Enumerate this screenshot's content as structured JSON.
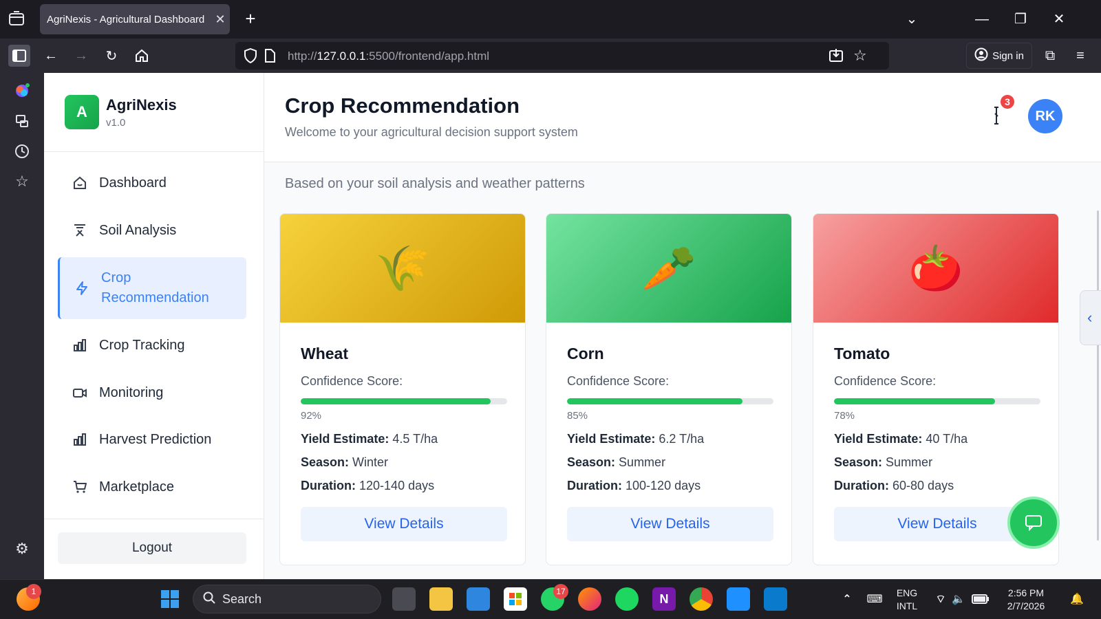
{
  "browser": {
    "tab_title": "AgriNexis - Agricultural Dashboard",
    "url_prefix": "http://",
    "url_host": "127.0.0.1",
    "url_rest": ":5500/frontend/app.html",
    "sign_in": "Sign in"
  },
  "app": {
    "brand_initial": "A",
    "brand_name": "AgriNexis",
    "brand_version": "v1.0",
    "menu": [
      {
        "label": "Dashboard",
        "icon": "home-icon"
      },
      {
        "label": "Soil Analysis",
        "icon": "soil-icon"
      },
      {
        "label": "Crop Recommendation",
        "icon": "bolt-icon",
        "active": true
      },
      {
        "label": "Crop Tracking",
        "icon": "bar-chart-icon"
      },
      {
        "label": "Monitoring",
        "icon": "video-icon"
      },
      {
        "label": "Harvest Prediction",
        "icon": "bar-chart-icon"
      },
      {
        "label": "Marketplace",
        "icon": "cart-icon"
      }
    ],
    "logout": "Logout"
  },
  "header": {
    "title": "Crop Recommendation",
    "subtitle": "Welcome to your agricultural decision support system",
    "notification_count": "3",
    "avatar_initials": "RK"
  },
  "main": {
    "section_subtitle": "Based on your soil analysis and weather patterns",
    "cards": [
      {
        "name": "Wheat",
        "emoji": "🌾",
        "confidence_label": "Confidence Score:",
        "confidence": 92,
        "confidence_text": "92%",
        "yield_label": "Yield Estimate:",
        "yield": "4.5 T/ha",
        "season_label": "Season:",
        "season": "Winter",
        "duration_label": "Duration:",
        "duration": "120-140 days",
        "button": "View Details",
        "gradient": [
          "#f6d23c",
          "#cf9a06"
        ]
      },
      {
        "name": "Corn",
        "emoji": "🥕",
        "confidence_label": "Confidence Score:",
        "confidence": 85,
        "confidence_text": "85%",
        "yield_label": "Yield Estimate:",
        "yield": "6.2 T/ha",
        "season_label": "Season:",
        "season": "Summer",
        "duration_label": "Duration:",
        "duration": "100-120 days",
        "button": "View Details",
        "gradient": [
          "#74e3a0",
          "#16a34a"
        ]
      },
      {
        "name": "Tomato",
        "emoji": "🍅",
        "confidence_label": "Confidence Score:",
        "confidence": 78,
        "confidence_text": "78%",
        "yield_label": "Yield Estimate:",
        "yield": "40 T/ha",
        "season_label": "Season:",
        "season": "Summer",
        "duration_label": "Duration:",
        "duration": "60-80 days",
        "button": "View Details",
        "gradient": [
          "#f7a0a0",
          "#e02a2a"
        ]
      }
    ]
  },
  "taskbar": {
    "search": "Search",
    "badge_left": "1",
    "whatsapp_badge": "17",
    "lang_top": "ENG",
    "lang_bottom": "INTL",
    "time": "2:56 PM",
    "date": "2/7/2026"
  },
  "colors": {
    "accent": "#3b82f6",
    "success": "#22c55e",
    "danger": "#ef4444"
  }
}
